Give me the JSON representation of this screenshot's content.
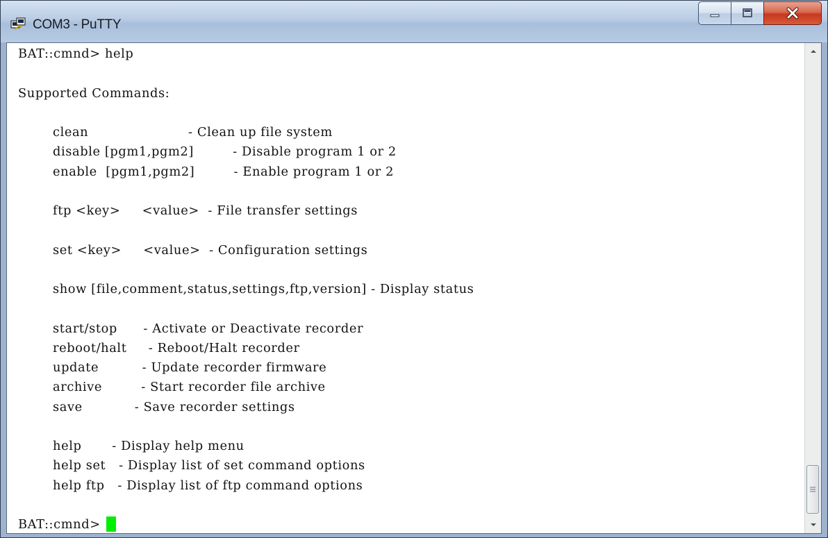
{
  "window": {
    "title": "COM3 - PuTTY",
    "app_icon": "putty-icon",
    "controls": [
      "minimize-icon",
      "maximize-icon",
      "close-icon"
    ]
  },
  "terminal": {
    "lines": [
      "BAT::cmnd> help",
      "",
      "Supported Commands:",
      "",
      "        clean                       - Clean up file system",
      "        disable [pgm1,pgm2]         - Disable program 1 or 2",
      "        enable  [pgm1,pgm2]         - Enable program 1 or 2",
      "",
      "        ftp <key>     <value>  - File transfer settings",
      "",
      "        set <key>     <value>  - Configuration settings",
      "",
      "        show [file,comment,status,settings,ftp,version] - Display status",
      "",
      "        start/stop      - Activate or Deactivate recorder",
      "        reboot/halt     - Reboot/Halt recorder",
      "        update          - Update recorder firmware",
      "        archive         - Start recorder file archive",
      "        save            - Save recorder settings",
      "",
      "        help       - Display help menu",
      "        help set   - Display list of set command options",
      "        help ftp   - Display list of ftp command options",
      ""
    ],
    "prompt": "BAT::cmnd> ",
    "cursor_color": "#00ee00"
  },
  "scrollbar": {
    "up_icon": "scroll-up-arrow-icon",
    "down_icon": "scroll-down-arrow-icon",
    "thumb_grip_icon": "grip-icon"
  }
}
